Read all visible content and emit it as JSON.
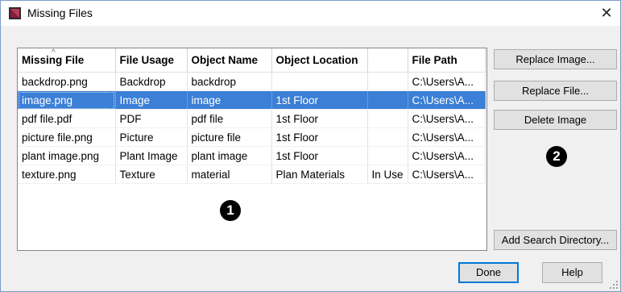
{
  "window": {
    "title": "Missing Files",
    "close_glyph": "✕",
    "icon": "chief-architect-app-icon"
  },
  "table": {
    "columns": [
      "Missing File",
      "File Usage",
      "Object Name",
      "Object Location",
      "",
      "File Path"
    ],
    "sort_indicator": "^",
    "rows": [
      [
        "backdrop.png",
        "Backdrop",
        "backdrop",
        "",
        "",
        "C:\\Users\\A..."
      ],
      [
        "image.png",
        "Image",
        "image",
        "1st Floor",
        "",
        "C:\\Users\\A..."
      ],
      [
        "pdf file.pdf",
        "PDF",
        "pdf file",
        "1st Floor",
        "",
        "C:\\Users\\A..."
      ],
      [
        "picture file.png",
        "Picture",
        "picture file",
        "1st Floor",
        "",
        "C:\\Users\\A..."
      ],
      [
        "plant image.png",
        "Plant Image",
        "plant image",
        "1st Floor",
        "",
        "C:\\Users\\A..."
      ],
      [
        "texture.png",
        "Texture",
        "material",
        "Plan Materials",
        "In Use",
        "C:\\Users\\A..."
      ]
    ],
    "selected_row": 1
  },
  "buttons": {
    "replace_image": "Replace Image...",
    "replace_file": "Replace File...",
    "delete_image": "Delete Image",
    "add_search_directory": "Add Search Directory...",
    "done": "Done",
    "help": "Help"
  },
  "callouts": {
    "one": "1",
    "two": "2"
  },
  "colors": {
    "selection": "#3b7fd6",
    "title_icon": "#8b1a3a",
    "default_button_border": "#0078d7"
  }
}
